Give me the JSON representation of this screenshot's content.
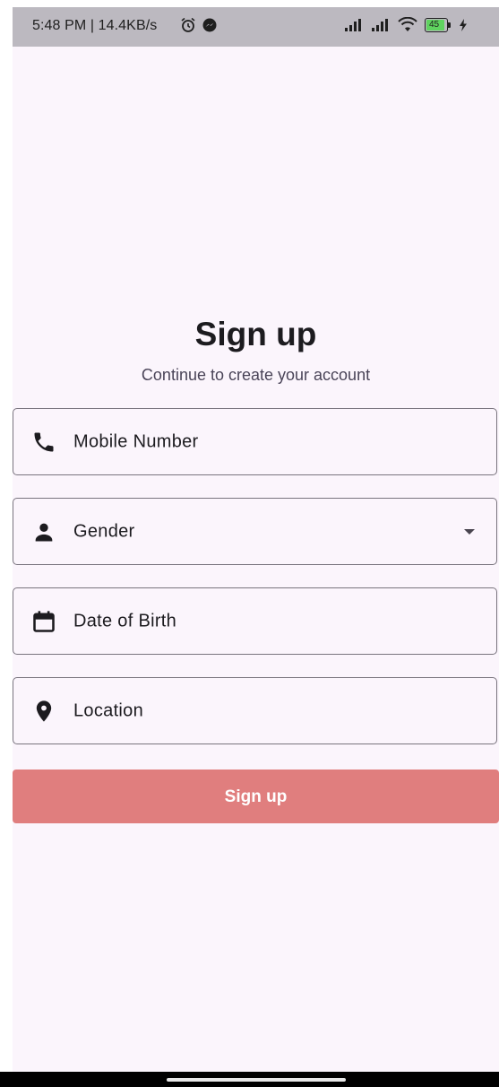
{
  "status_bar": {
    "time": "5:48 PM | 14.4KB/s",
    "battery_level": "45",
    "icons": [
      "alarm-icon",
      "messenger-icon",
      "signal-icon",
      "signal-icon",
      "wifi-icon",
      "battery-icon",
      "charging-icon"
    ]
  },
  "header": {
    "title": "Sign up",
    "subtitle": "Continue to create your account"
  },
  "form": {
    "mobile": {
      "label": "Mobile Number",
      "icon": "phone-icon"
    },
    "gender": {
      "label": "Gender",
      "icon": "person-icon"
    },
    "dob": {
      "label": "Date of Birth",
      "icon": "calendar-icon"
    },
    "location": {
      "label": "Location",
      "icon": "location-pin-icon"
    }
  },
  "submit": {
    "label": "Sign up"
  },
  "colors": {
    "background": "#fbf5fc",
    "status_bar": "#bcb9c0",
    "button": "#e07e7e",
    "border": "#79747e",
    "text": "#1c1b1f"
  }
}
